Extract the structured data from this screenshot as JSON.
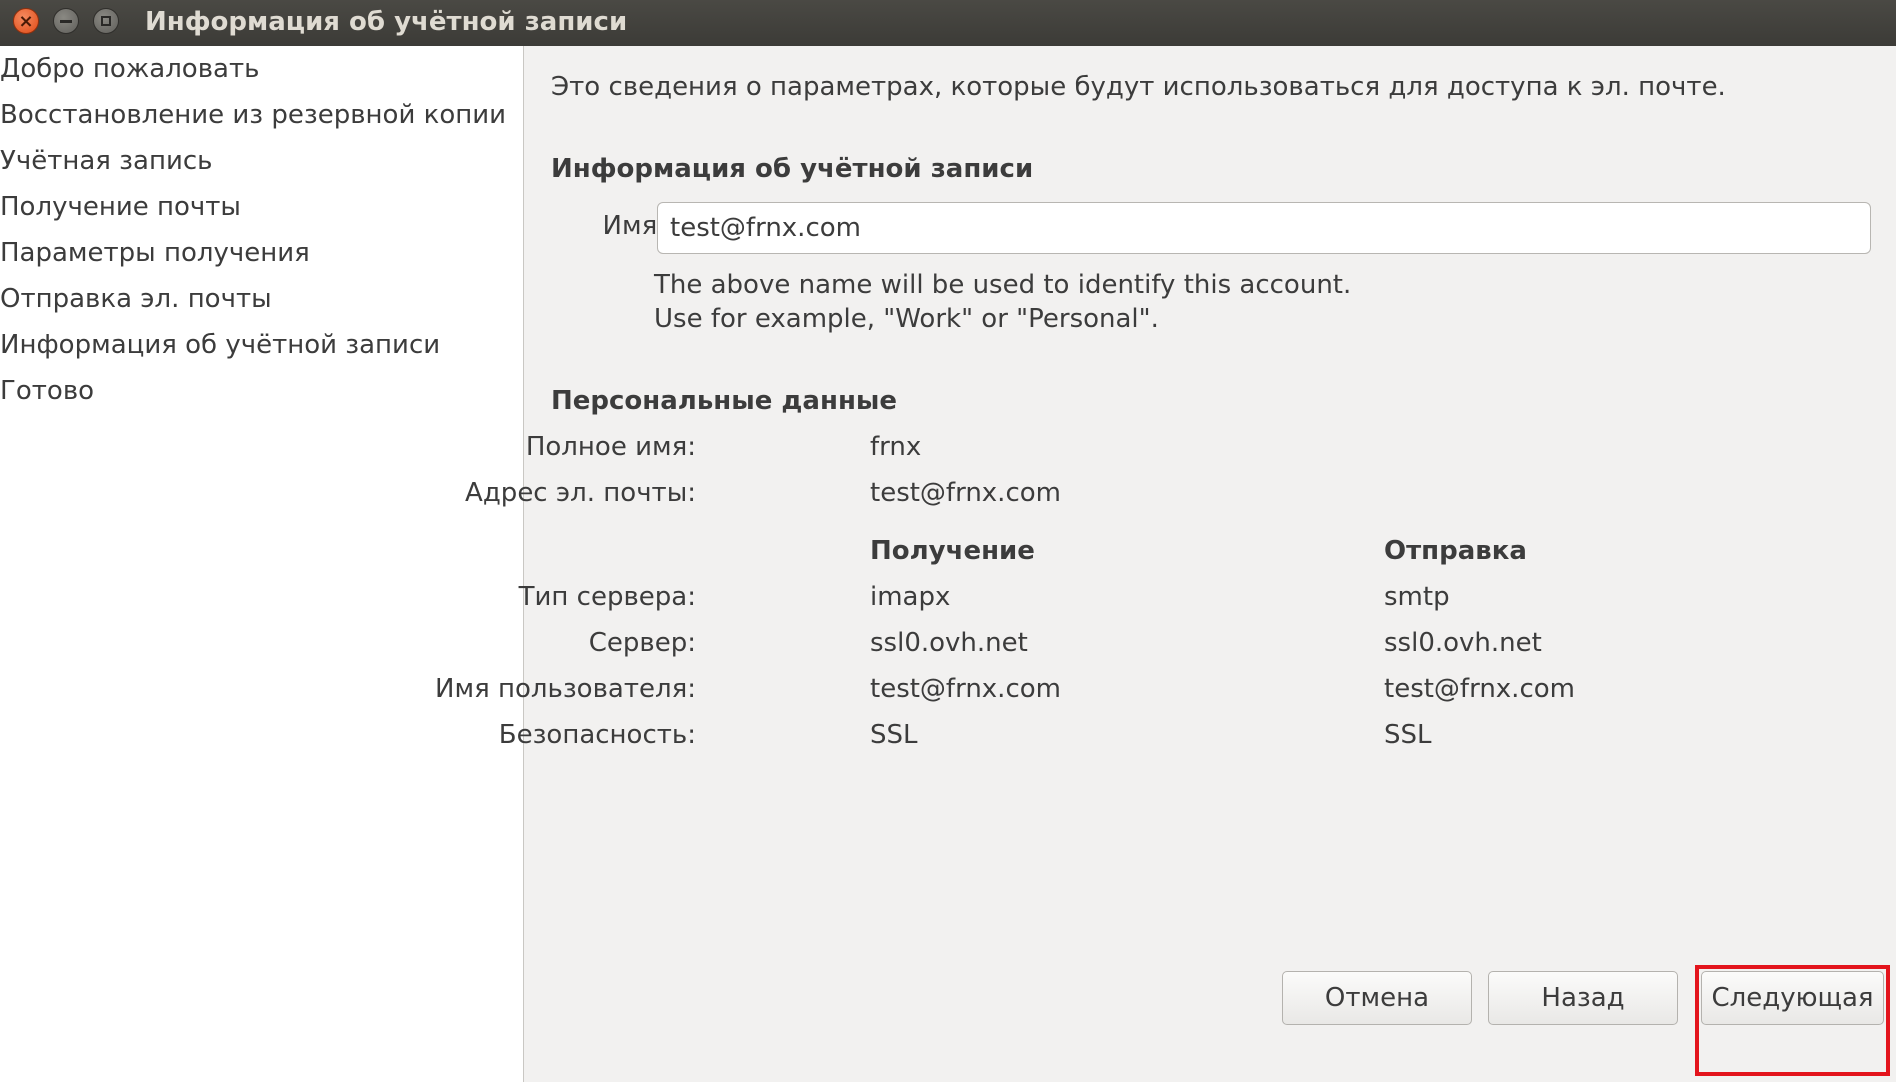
{
  "window": {
    "title": "Информация об учётной записи"
  },
  "sidebar": {
    "items": [
      {
        "label": "Добро пожаловать"
      },
      {
        "label": "Восстановление из резервной копии"
      },
      {
        "label": "Учётная запись"
      },
      {
        "label": "Получение почты"
      },
      {
        "label": "Параметры получения"
      },
      {
        "label": "Отправка эл. почты"
      },
      {
        "label": "Информация об учётной записи"
      },
      {
        "label": "Готово"
      }
    ]
  },
  "content": {
    "description": "Это сведения о параметрах, которые будут использоваться для доступа к эл. почте.",
    "account_section_title": "Информация об учётной записи",
    "name_label": "Имя:",
    "name_value": "test@frnx.com",
    "hint_line1": "The above name will be used to identify this account.",
    "hint_line2": "Use for example, \"Work\" or \"Personal\".",
    "personal_section_title": "Персональные данные",
    "full_name_label": "Полное имя:",
    "full_name_value": "frnx",
    "email_label": "Адрес эл. почты:",
    "email_value": "test@frnx.com",
    "receiving_header": "Получение",
    "sending_header": "Отправка",
    "rows": [
      {
        "label": "Тип сервера:",
        "receiving": "imapx",
        "sending": "smtp"
      },
      {
        "label": "Сервер:",
        "receiving": "ssl0.ovh.net",
        "sending": "ssl0.ovh.net"
      },
      {
        "label": "Имя пользователя:",
        "receiving": "test@frnx.com",
        "sending": "test@frnx.com"
      },
      {
        "label": "Безопасность:",
        "receiving": "SSL",
        "sending": "SSL"
      }
    ]
  },
  "buttons": {
    "cancel": "Отмена",
    "back": "Назад",
    "next": "Следующая"
  },
  "colors": {
    "highlight": "#e3141c",
    "titlebar": "#3c3b37",
    "close_button": "#df4a16"
  }
}
